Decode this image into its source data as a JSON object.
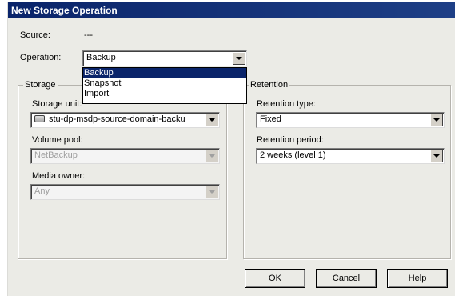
{
  "window": {
    "title": "New Storage Operation"
  },
  "source": {
    "label": "Source:",
    "value": "---"
  },
  "operation": {
    "label": "Operation:",
    "selected": "Backup",
    "options": [
      "Backup",
      "Snapshot",
      "Import"
    ]
  },
  "storage": {
    "group_title": "Storage",
    "storage_unit_label": "Storage unit:",
    "storage_unit_value": "stu-dp-msdp-source-domain-backu",
    "volume_pool_label": "Volume pool:",
    "volume_pool_value": "NetBackup",
    "media_owner_label": "Media owner:",
    "media_owner_value": "Any"
  },
  "retention": {
    "group_title": "Retention",
    "type_label": "Retention type:",
    "type_value": "Fixed",
    "period_label": "Retention period:",
    "period_value": "2 weeks (level 1)"
  },
  "buttons": {
    "ok": "OK",
    "cancel": "Cancel",
    "help": "Help"
  },
  "colors": {
    "titlebar": "#0a246a",
    "selection": "#0a246a",
    "dialog_bg": "#ebebe6"
  }
}
